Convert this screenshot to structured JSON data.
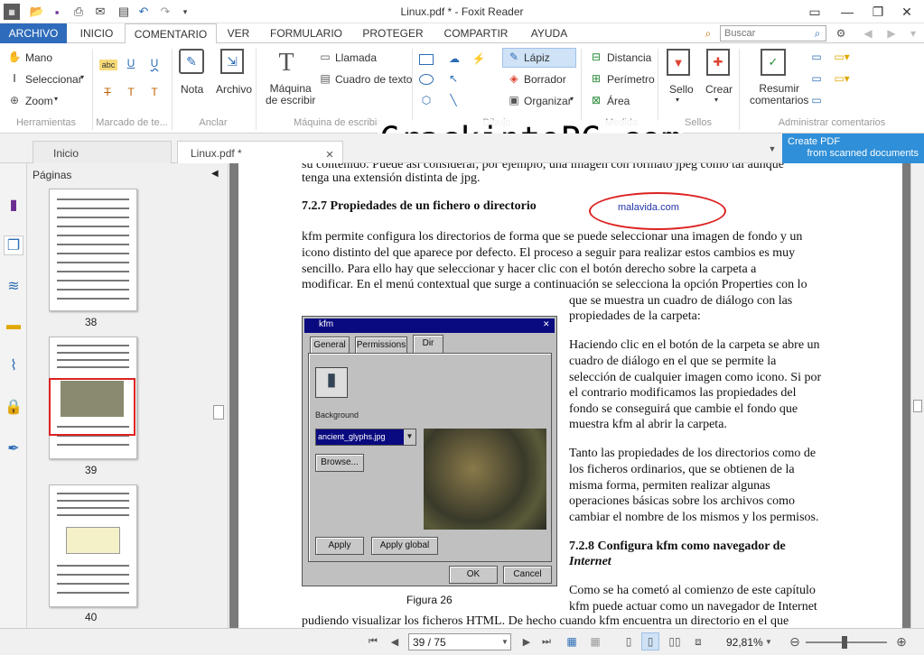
{
  "window": {
    "title": "Linux.pdf * - Foxit Reader"
  },
  "tabs": [
    {
      "label": "ARCHIVO"
    },
    {
      "label": "INICIO"
    },
    {
      "label": "COMENTARIO"
    },
    {
      "label": "VER"
    },
    {
      "label": "FORMULARIO"
    },
    {
      "label": "PROTEGER"
    },
    {
      "label": "COMPARTIR"
    },
    {
      "label": "AYUDA"
    }
  ],
  "search": {
    "placeholder": "Buscar"
  },
  "ribbon": {
    "mano": "Mano",
    "seleccionar": "Seleccionar",
    "zoom": "Zoom",
    "nota": "Nota",
    "archivo": "Archivo",
    "maquina": "Máquina\nde escribir",
    "llamada": "Llamada",
    "cuadro": "Cuadro de texto",
    "lapiz": "Lápiz",
    "borrador": "Borrador",
    "organizar": "Organizar",
    "distancia": "Distancia",
    "perimetro": "Perímetro",
    "area": "Área",
    "sello": "Sello",
    "crear": "Crear",
    "resumir": "Resumir\ncomentarios",
    "groups": {
      "herramientas": "Herramientas",
      "marcado": "Marcado de te...",
      "anclar": "Anclar",
      "maquina": "Máquina de escribir",
      "dibujo": "Dibujo",
      "medida": "Medida",
      "sellos": "Sellos",
      "administrar": "Administrar comentarios"
    }
  },
  "doc_tabs": {
    "inicio": "Inicio",
    "linux": "Linux.pdf *"
  },
  "watermark": "CrackintoPC.com",
  "ad": {
    "line1": "Create PDF",
    "line2": "from scanned documents"
  },
  "panel": {
    "title": "Páginas",
    "pages": [
      "38",
      "39",
      "40"
    ]
  },
  "page": {
    "top_line": "su contenido. Puede así considerar, por ejemplo, una imagen con formato jpeg como tal aunque",
    "top_line2": "tenga una extensión distinta de jpg.",
    "heading1": "7.2.7  Propiedades de un fichero o directorio",
    "annotation": "malavida.com",
    "para1": [
      "kfm permite configura los directorios de forma que se puede seleccionar una imagen de fondo y un",
      "icono distinto del que aparece por defecto. El proceso a seguir para realizar estos cambios es muy",
      "sencillo. Para ello hay que seleccionar y hacer clic con el botón derecho sobre la carpeta a",
      "modificar. En el menú contextual que surge a continuación se selecciona la opción Properties con lo"
    ],
    "right_lines": [
      "que se muestra un cuadro de diálogo con las",
      "propiedades de la carpeta:"
    ],
    "para2": [
      "Haciendo clic en el botón de la carpeta se abre un",
      "cuadro de diálogo en el que se permite la",
      "selección de cualquier imagen como icono. Si por",
      "el contrario modificamos las propiedades del",
      "fondo se conseguirá que cambie el fondo que",
      "muestra kfm al abrir la carpeta."
    ],
    "para3": [
      "Tanto las propiedades de los directorios como de",
      "los ficheros ordinarios, que se obtienen de la",
      "misma forma, permiten realizar algunas",
      "operaciones básicas sobre los archivos como",
      "cambiar el nombre de los mismos y los permisos."
    ],
    "heading2a": "7.2.8  Configura kfm como navegador de",
    "heading2b": "Internet",
    "para4": [
      "Como se ha cometó al comienzo de este capítulo",
      "kfm puede actuar como un navegador de Internet"
    ],
    "bottom": "pudiendo visualizar los ficheros HTML. De hecho cuando kfm encuentra un directorio en el que",
    "figure": "Figura 26"
  },
  "dialog": {
    "title": "kfm",
    "tabs": [
      "General",
      "Permissions",
      "Dir"
    ],
    "background_label": "Background",
    "select_value": "ancient_glyphs.jpg",
    "browse": "Browse...",
    "apply": "Apply",
    "apply_global": "Apply global",
    "ok": "OK",
    "cancel": "Cancel"
  },
  "status": {
    "page": "39 / 75",
    "zoom": "92,81%"
  }
}
